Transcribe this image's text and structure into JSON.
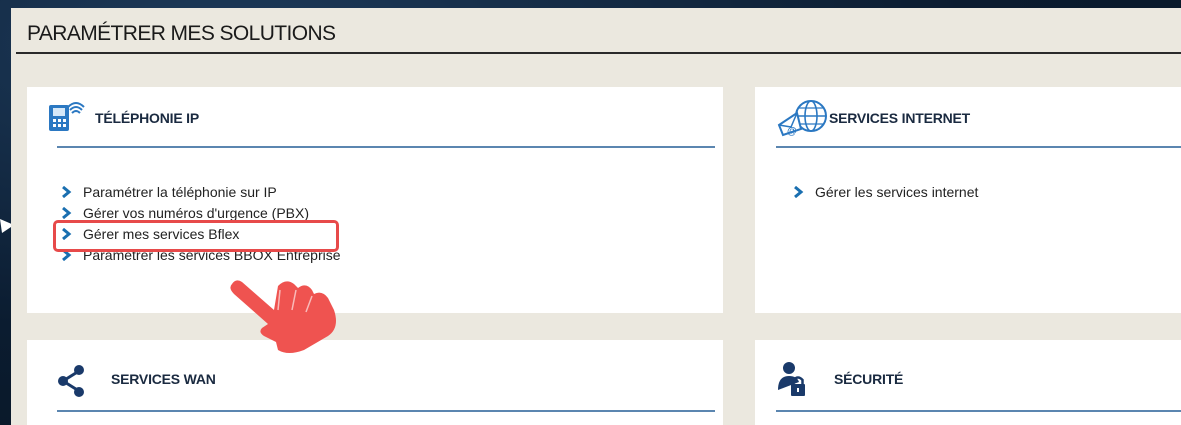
{
  "page": {
    "title": "PARAMÉTRER MES SOLUTIONS"
  },
  "cards": {
    "telephonie": {
      "title": "TÉLÉPHONIE IP",
      "icon": "ip-phone-icon",
      "links": [
        "Paramétrer la téléphonie sur IP",
        "Gérer vos numéros d'urgence (PBX)",
        "Gérer mes services Bflex",
        "Paramétrer les services BBOX Entreprise"
      ]
    },
    "internet": {
      "title": "SERVICES INTERNET",
      "icon": "globe-mail-icon",
      "links": [
        "Gérer les services internet"
      ]
    },
    "wan": {
      "title": "SERVICES WAN",
      "icon": "share-icon"
    },
    "securite": {
      "title": "SÉCURITÉ",
      "icon": "lock-user-icon"
    }
  },
  "colors": {
    "accent": "#1a6fb0",
    "rule": "#5b86b0",
    "highlight": "#e74a4a",
    "panel": "#ebe8df"
  }
}
